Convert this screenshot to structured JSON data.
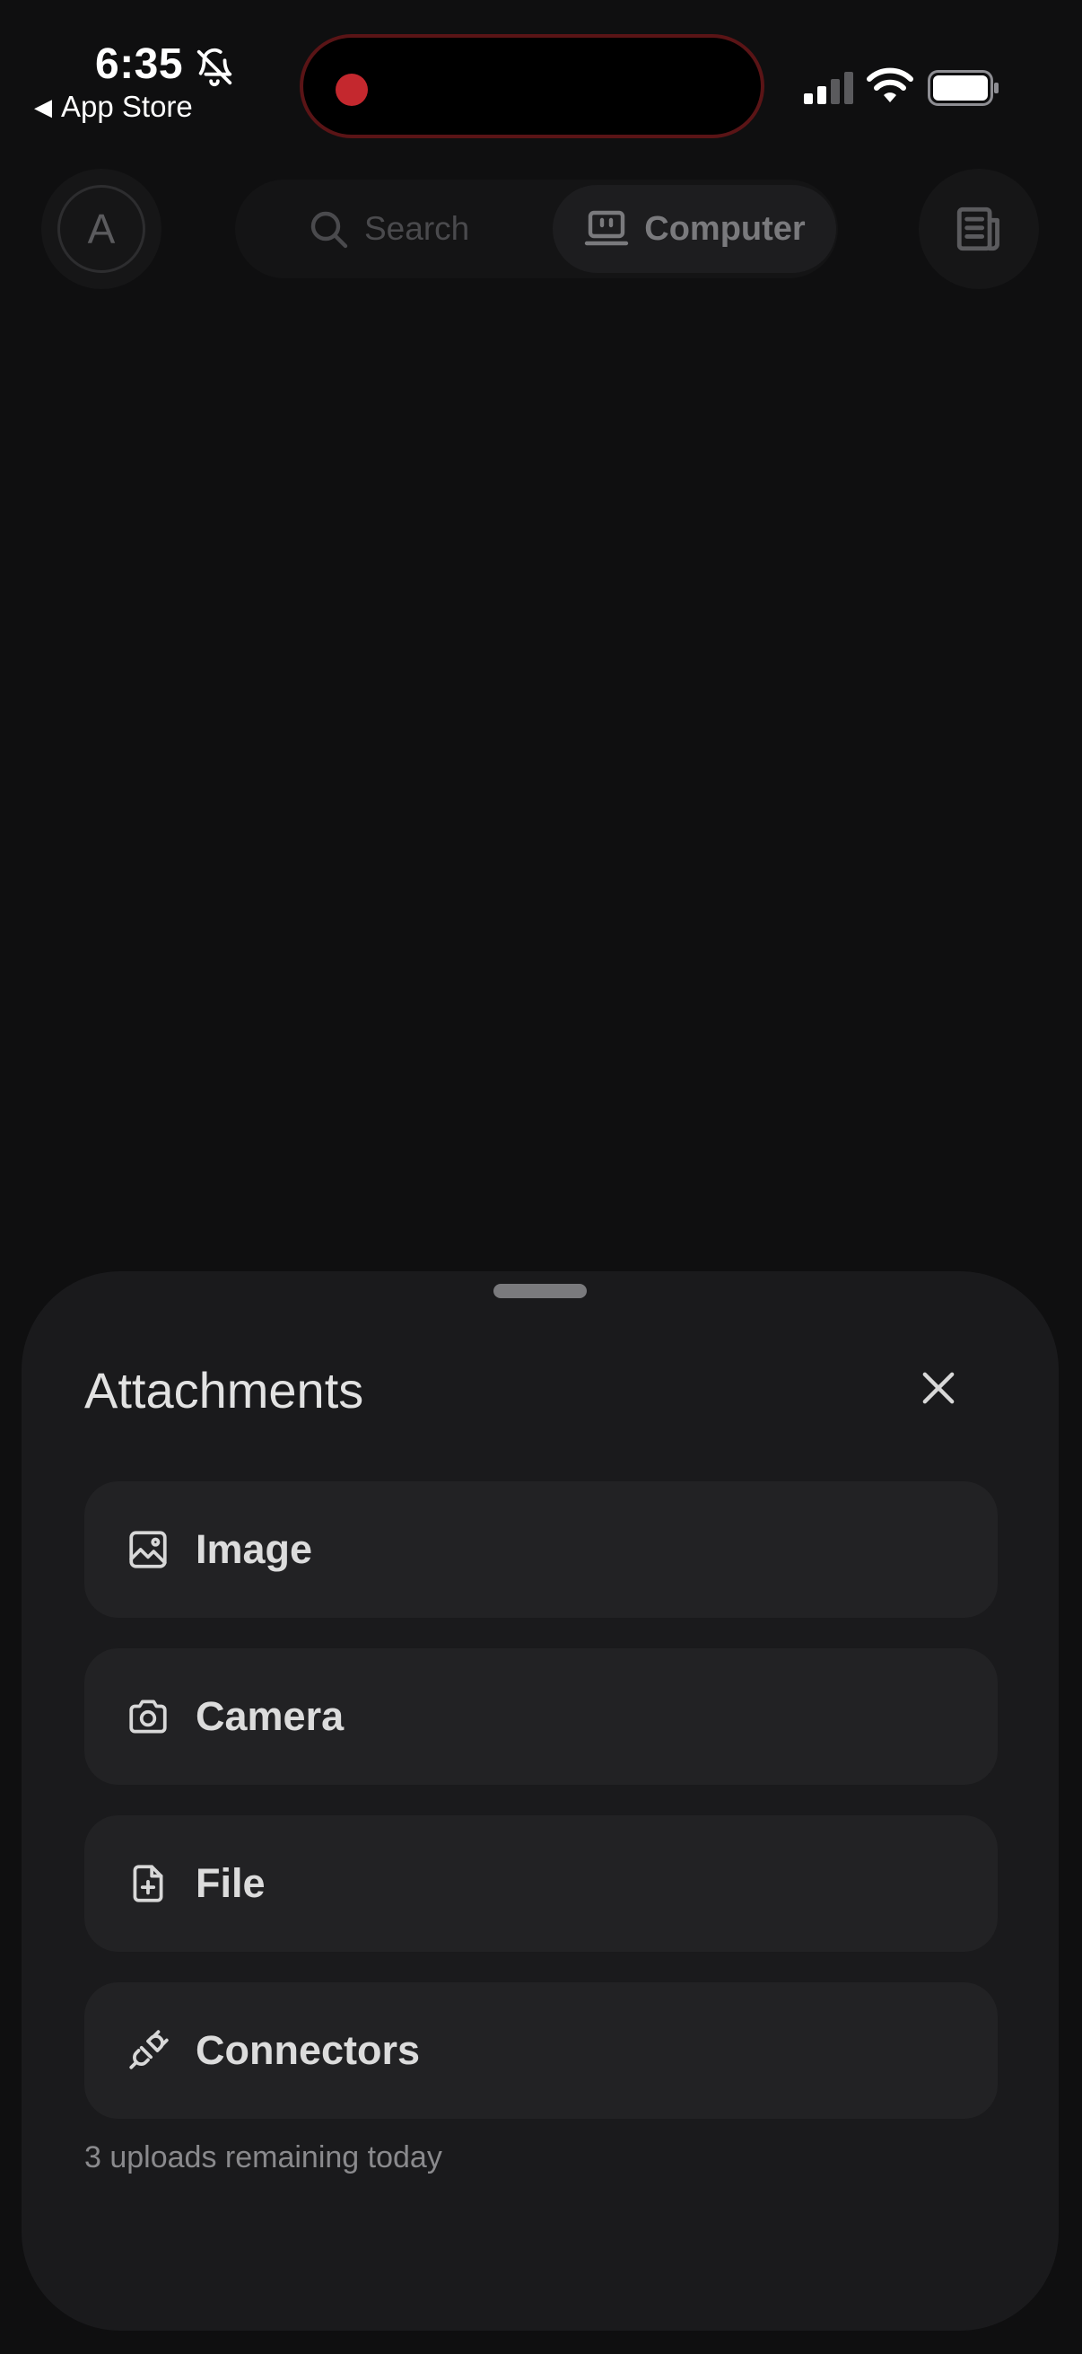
{
  "status_bar": {
    "time": "6:35",
    "back_app": "App Store"
  },
  "top_nav": {
    "avatar_initial": "A",
    "modes": {
      "search_label": "Search",
      "computer_label": "Computer",
      "selected": "Computer"
    }
  },
  "sheet": {
    "title": "Attachments",
    "options": [
      {
        "label": "Image",
        "icon": "image-icon"
      },
      {
        "label": "Camera",
        "icon": "camera-icon"
      },
      {
        "label": "File",
        "icon": "file-plus-icon"
      },
      {
        "label": "Connectors",
        "icon": "plug-icon"
      }
    ],
    "footer_note": "3 uploads remaining today"
  },
  "colors": {
    "background": "#0f0f10",
    "sheet": "#1a1a1c",
    "option_bg": "#222224",
    "recording_dot": "#c4282e"
  }
}
